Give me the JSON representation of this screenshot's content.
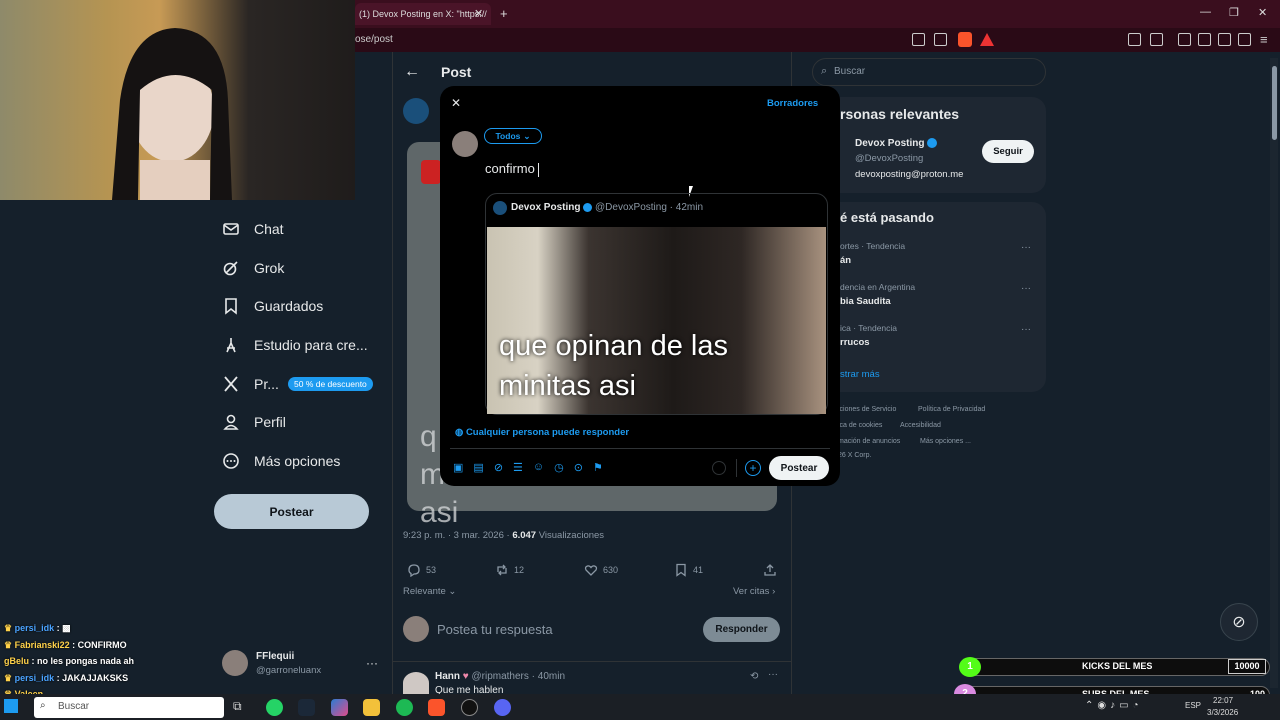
{
  "browser": {
    "tab_title": "(1) Devox Posting en X: \"https://",
    "url": "ose/post"
  },
  "header": {
    "title": "Post"
  },
  "search": {
    "placeholder": "Buscar"
  },
  "nav": [
    {
      "label": "Chat",
      "icon": "mail-icon"
    },
    {
      "label": "Grok",
      "icon": "grok-icon"
    },
    {
      "label": "Guardados",
      "icon": "bookmark-icon"
    },
    {
      "label": "Estudio para cre...",
      "icon": "studio-icon"
    },
    {
      "label": "Pr...",
      "icon": "x-logo-icon",
      "badge": "50 % de descuento"
    },
    {
      "label": "Perfil",
      "icon": "person-icon"
    },
    {
      "label": "Más opciones",
      "icon": "more-circle-icon"
    }
  ],
  "post_button": "Postear",
  "account": {
    "name": "FFlequii",
    "handle": "@garroneluanx"
  },
  "modal": {
    "drafts": "Borradores",
    "audience": "Todos",
    "text": "confirmo",
    "quote": {
      "author": "Devox Posting",
      "handle": "@DevoxPosting",
      "time": "· 42min",
      "image_caption": "que opinan de las minitas asi"
    },
    "reply_setting": "Cualquier persona puede responder",
    "submit": "Postear"
  },
  "behind_post": {
    "caption_partial": "q minitas asi",
    "meta_time": "9:23 p. m. · 3 mar. 2026 ·",
    "views_count": "6.047",
    "views_label": "Visualizaciones",
    "replies": "53",
    "reposts": "12",
    "likes": "630",
    "bookmarks": "41",
    "relevant": "Relevante",
    "quotes": "Ver citas",
    "reply_placeholder": "Postea tu respuesta",
    "reply_button": "Responder"
  },
  "reply": {
    "name": "Hann",
    "handle": "@ripmathers",
    "time": "· 40min",
    "text": "Que me hablen"
  },
  "right": {
    "relevant_title": "rsonas relevantes",
    "person_name": "Devox Posting",
    "person_handle": "@DevoxPosting",
    "person_bio": "devoxposting@proton.me",
    "follow": "Seguir",
    "trends_title": "é está pasando",
    "trends": [
      {
        "context": "ortes · Tendencia",
        "name": "án"
      },
      {
        "context": "dencia en Argentina",
        "name": "bia Saudita"
      },
      {
        "context": "ica · Tendencia",
        "name": "rrucos"
      }
    ],
    "show_more": "strar más",
    "footer": [
      "iciones de Servicio",
      "Política de Privacidad",
      "ica de cookies",
      "Accesibilidad",
      "mación de anuncios",
      "Más opciones ...",
      "26 X Corp."
    ]
  },
  "chat_messages": [
    {
      "user": "persi_idk",
      "text": ":",
      "color": "#4aa3ff"
    },
    {
      "user": "Fabrianski22",
      "text": ": CONFIRMO",
      "color": "#ffd24a"
    },
    {
      "user": "gBelu",
      "text": ": no les pongas nada ah",
      "color": "#ffd24a"
    },
    {
      "user": "persi_idk",
      "text": ": JAKAJJAKSKS",
      "color": "#4aa3ff"
    },
    {
      "user": "Valeen_",
      "text": "",
      "color": "#ffd24a"
    }
  ],
  "overlays": {
    "kicks_rank": "1",
    "kicks_label": "KICKS DEL MES",
    "kicks_value": "10000",
    "subs_rank": "2",
    "subs_label": "SUBS DEL MES",
    "subs_value": "100"
  },
  "taskbar": {
    "search": "Buscar",
    "lang": "ESP",
    "time": "22:07",
    "date": "3/3/2026"
  }
}
